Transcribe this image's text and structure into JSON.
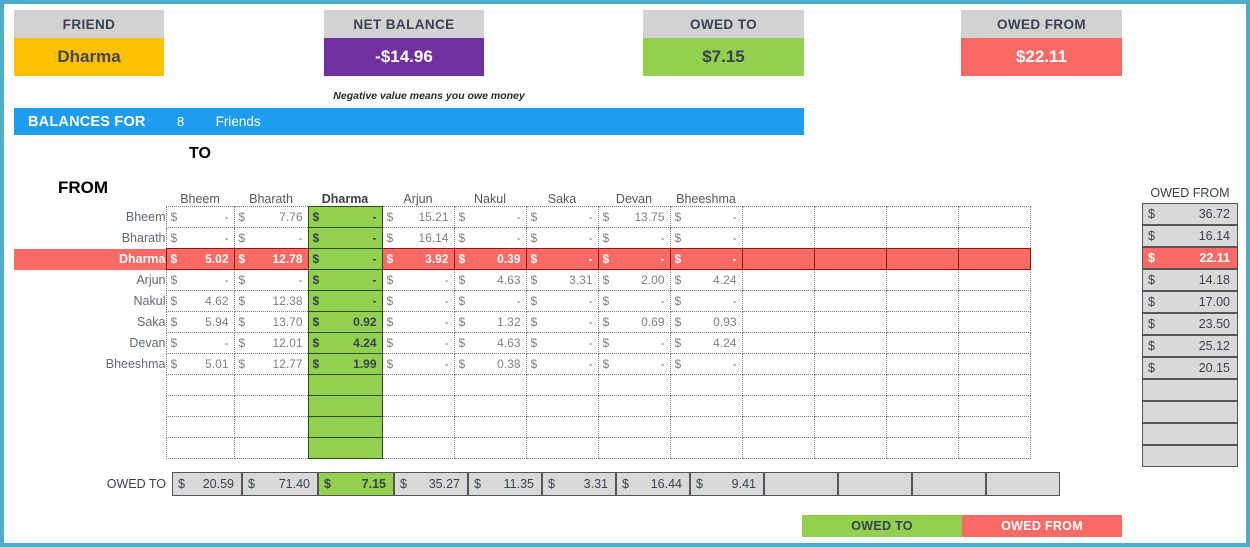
{
  "kpis": [
    {
      "title": "FRIEND",
      "value": "Dharma",
      "style": "gold"
    },
    {
      "title": "NET BALANCE",
      "value": "-$14.96",
      "style": "purple"
    },
    {
      "title": "OWED TO",
      "value": "$7.15",
      "style": "green"
    },
    {
      "title": "OWED FROM",
      "value": "$22.11",
      "style": "red"
    }
  ],
  "net_balance_note": "Negative value means you owe money",
  "balances_bar": {
    "label": "BALANCES FOR",
    "count": "8",
    "suffix": "Friends"
  },
  "axis": {
    "to_label": "TO",
    "from_label": "FROM"
  },
  "selected_friend": "Dharma",
  "matrix": {
    "columns": [
      "Bheem",
      "Bharath",
      "Dharma",
      "Arjun",
      "Nakul",
      "Saka",
      "Devan",
      "Bheeshma",
      "",
      "",
      "",
      ""
    ],
    "rows": [
      "Bheem",
      "Bharath",
      "Dharma",
      "Arjun",
      "Nakul",
      "Saka",
      "Devan",
      "Bheeshma",
      "",
      "",
      "",
      ""
    ],
    "currency": "$",
    "zero_mark": "-",
    "values": [
      [
        "-",
        "7.76",
        "-",
        "15.21",
        "-",
        "-",
        "13.75",
        "-",
        "",
        "",
        "",
        ""
      ],
      [
        "-",
        "-",
        "-",
        "16.14",
        "-",
        "-",
        "-",
        "-",
        "",
        "",
        "",
        ""
      ],
      [
        "5.02",
        "12.78",
        "-",
        "3.92",
        "0.39",
        "-",
        "-",
        "-",
        "",
        "",
        "",
        ""
      ],
      [
        "-",
        "-",
        "-",
        "-",
        "4.63",
        "3.31",
        "2.00",
        "4.24",
        "",
        "",
        "",
        ""
      ],
      [
        "4.62",
        "12.38",
        "-",
        "-",
        "-",
        "-",
        "-",
        "-",
        "",
        "",
        "",
        ""
      ],
      [
        "5.94",
        "13.70",
        "0.92",
        "-",
        "1.32",
        "-",
        "0.69",
        "0.93",
        "",
        "",
        "",
        ""
      ],
      [
        "-",
        "12.01",
        "4.24",
        "-",
        "4.63",
        "-",
        "-",
        "4.24",
        "",
        "",
        "",
        ""
      ],
      [
        "5.01",
        "12.77",
        "1.99",
        "-",
        "0.38",
        "-",
        "-",
        "-",
        "",
        "",
        "",
        ""
      ],
      [
        "",
        "",
        "",
        "",
        "",
        "",
        "",
        "",
        "",
        "",
        "",
        ""
      ],
      [
        "",
        "",
        "",
        "",
        "",
        "",
        "",
        "",
        "",
        "",
        "",
        ""
      ],
      [
        "",
        "",
        "",
        "",
        "",
        "",
        "",
        "",
        "",
        "",
        "",
        ""
      ],
      [
        "",
        "",
        "",
        "",
        "",
        "",
        "",
        "",
        "",
        "",
        "",
        ""
      ]
    ]
  },
  "owed_from": {
    "header": "OWED FROM",
    "currency": "$",
    "values": [
      "36.72",
      "16.14",
      "22.11",
      "14.18",
      "17.00",
      "23.50",
      "25.12",
      "20.15",
      "",
      "",
      "",
      ""
    ]
  },
  "owed_to": {
    "label": "OWED TO",
    "currency": "$",
    "values": [
      "20.59",
      "71.40",
      "7.15",
      "35.27",
      "11.35",
      "3.31",
      "16.44",
      "9.41",
      "",
      "",
      "",
      ""
    ]
  },
  "legend": {
    "owed_to": "OWED TO",
    "owed_from": "OWED FROM"
  },
  "colors": {
    "gold": "#FFC000",
    "purple": "#7030A0",
    "green": "#92D050",
    "red": "#FB6A64",
    "blue": "#1E9CEF",
    "gray_header": "#D2D2D2",
    "gray_cell": "#D9D9D9",
    "border_teal": "#4BACC6"
  }
}
